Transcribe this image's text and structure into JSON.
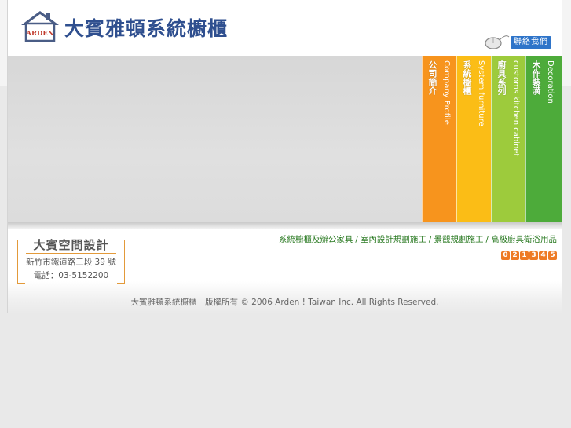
{
  "header": {
    "title": "大賓雅頓系統櫥櫃",
    "logo_text": "ARDEN",
    "contact_label": "聯絡我們"
  },
  "nav": [
    {
      "zh": "公司簡介",
      "en": "Company Profile",
      "color": "#f7941d"
    },
    {
      "zh": "系統櫥櫃",
      "en": "System furniture",
      "color": "#fbbd16"
    },
    {
      "zh": "廚具系列",
      "en": "customs kitchen cabinet",
      "color": "#9dcb3c"
    },
    {
      "zh": "木作裝潢",
      "en": "Decoration",
      "color": "#4dab3a"
    }
  ],
  "company": {
    "name": "大賓空間設計",
    "address": "新竹市鐵道路三段 39 號",
    "phone": "電話：03-5152200"
  },
  "services": {
    "item1": "系統櫥櫃及辦公家具",
    "item2": "室內設計規劃施工",
    "item3": "景觀規劃施工",
    "item4": "高級廚具衛浴用品",
    "separator": "/"
  },
  "counter": [
    "0",
    "2",
    "1",
    "3",
    "4",
    "5"
  ],
  "footer": {
    "copyright": "大賓雅頓系統櫥櫃　版權所有 © 2006 Arden ! Taiwan Inc. All Rights Reserved."
  }
}
